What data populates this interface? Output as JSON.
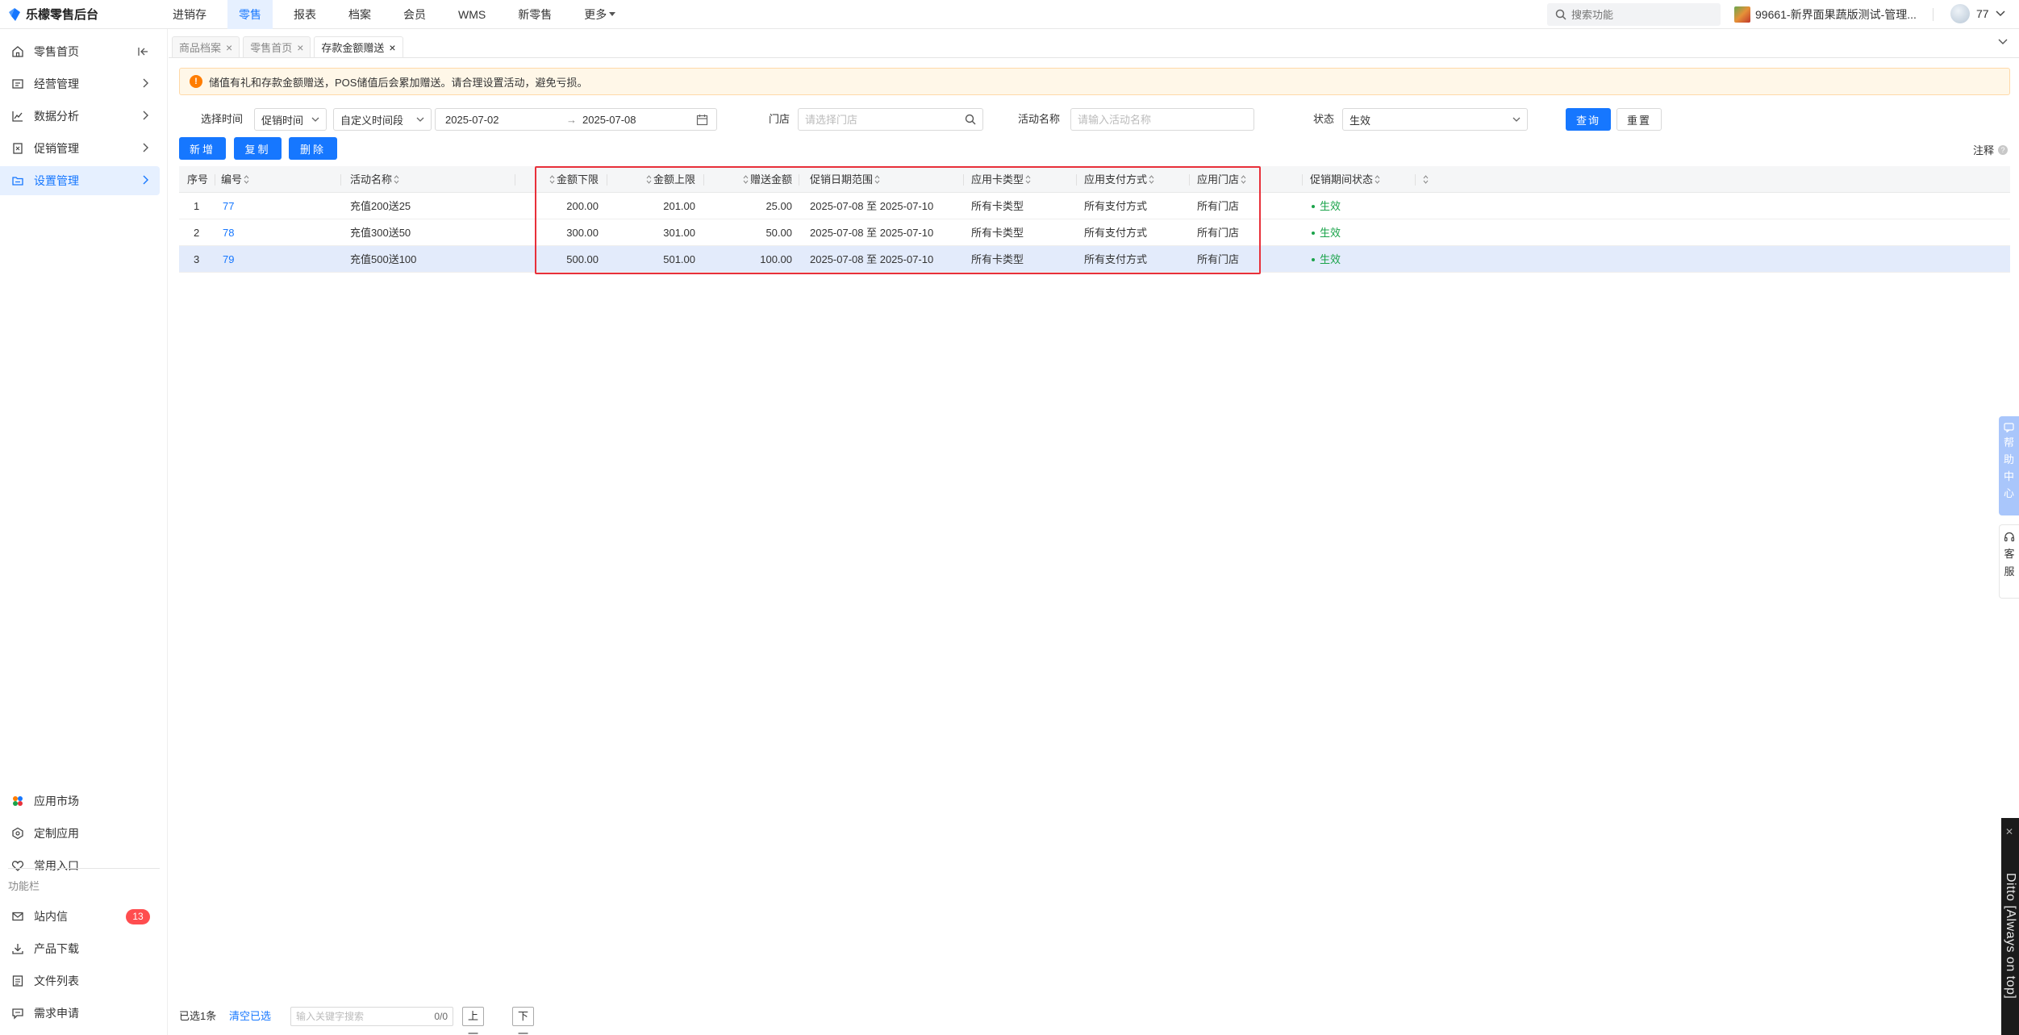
{
  "app": {
    "logo_text": "乐檬零售后台"
  },
  "topnav": {
    "items": [
      {
        "label": "进销存",
        "active": false
      },
      {
        "label": "零售",
        "active": true
      },
      {
        "label": "报表",
        "active": false
      },
      {
        "label": "档案",
        "active": false
      },
      {
        "label": "会员",
        "active": false
      },
      {
        "label": "WMS",
        "active": false
      },
      {
        "label": "新零售",
        "active": false
      }
    ],
    "more_label": "更多",
    "search_placeholder": "搜索功能",
    "store_name": "99661-新界面果蔬版测试-管理...",
    "user_name": "77"
  },
  "sidebar": {
    "items": [
      {
        "label": "零售首页",
        "icon": "home-icon"
      },
      {
        "label": "经营管理",
        "icon": "dashboard-icon"
      },
      {
        "label": "数据分析",
        "icon": "chart-line-icon"
      },
      {
        "label": "促销管理",
        "icon": "coupon-icon"
      },
      {
        "label": "设置管理",
        "icon": "folder-icon",
        "active": true
      }
    ],
    "bottom_items": [
      {
        "label": "应用市场",
        "icon": "app-market-icon"
      },
      {
        "label": "定制应用",
        "icon": "custom-app-icon"
      },
      {
        "label": "常用入口",
        "icon": "heart-icon"
      }
    ],
    "function_group_label": "功能栏",
    "function_items": [
      {
        "label": "站内信",
        "icon": "mail-icon",
        "badge": "13"
      },
      {
        "label": "产品下载",
        "icon": "download-icon"
      },
      {
        "label": "文件列表",
        "icon": "file-list-icon"
      },
      {
        "label": "需求申请",
        "icon": "request-icon"
      }
    ]
  },
  "tabs": [
    {
      "label": "商品档案",
      "active": false
    },
    {
      "label": "零售首页",
      "active": false
    },
    {
      "label": "存款金额赠送",
      "active": true
    }
  ],
  "notice": {
    "text": "储值有礼和存款金额赠送，POS储值后会累加赠送。请合理设置活动，避免亏损。"
  },
  "filters": {
    "time_label": "选择时间",
    "time_type": "促销时间",
    "time_range_type": "自定义时间段",
    "date_start": "2025-07-02",
    "date_arrow": "→",
    "date_end": "2025-07-08",
    "store_label": "门店",
    "store_placeholder": "请选择门店",
    "activity_label": "活动名称",
    "activity_placeholder": "请输入活动名称",
    "status_label": "状态",
    "status_value": "生效",
    "query_label": "查询",
    "reset_label": "重置"
  },
  "actions": {
    "add_label": "新增",
    "copy_label": "复制",
    "delete_label": "删除",
    "note_label": "注释"
  },
  "table": {
    "headers": {
      "index": "序号",
      "code": "编号",
      "name": "活动名称",
      "min_amount": "金额下限",
      "max_amount": "金额上限",
      "gift_amount": "赠送金额",
      "date_range": "促销日期范围",
      "card_type": "应用卡类型",
      "pay_method": "应用支付方式",
      "store": "应用门店",
      "status": "促销期间状态"
    },
    "rows": [
      {
        "index": "1",
        "code": "77",
        "name": "充值200送25",
        "min_amount": "200.00",
        "max_amount": "201.00",
        "gift_amount": "25.00",
        "date_range": "2025-07-08 至 2025-07-10",
        "card_type": "所有卡类型",
        "pay_method": "所有支付方式",
        "store": "所有门店",
        "status": "生效",
        "selected": false
      },
      {
        "index": "2",
        "code": "78",
        "name": "充值300送50",
        "min_amount": "300.00",
        "max_amount": "301.00",
        "gift_amount": "50.00",
        "date_range": "2025-07-08 至 2025-07-10",
        "card_type": "所有卡类型",
        "pay_method": "所有支付方式",
        "store": "所有门店",
        "status": "生效",
        "selected": false
      },
      {
        "index": "3",
        "code": "79",
        "name": "充值500送100",
        "min_amount": "500.00",
        "max_amount": "501.00",
        "gift_amount": "100.00",
        "date_range": "2025-07-08 至 2025-07-10",
        "card_type": "所有卡类型",
        "pay_method": "所有支付方式",
        "store": "所有门店",
        "status": "生效",
        "selected": true
      }
    ]
  },
  "bottom": {
    "selected_text": "已选1条",
    "clear_label": "清空已选",
    "search_placeholder": "输入关键字搜索",
    "match_count": "0/0",
    "prev_label": "上一个",
    "next_label": "下一个"
  },
  "floating": {
    "help_chars": [
      "帮",
      "助",
      "中",
      "心"
    ],
    "service_chars": [
      "客",
      "服"
    ],
    "ditto_text": "Ditto [Always on top]"
  },
  "colors": {
    "primary": "#1677ff",
    "active_bg": "#e6f0ff",
    "selected_row": "#e3ebfb",
    "status_green": "#1aa34a",
    "badge_red": "#ff4d4f",
    "highlight_red": "#e8303a",
    "notice_bg": "#fff7e8"
  }
}
